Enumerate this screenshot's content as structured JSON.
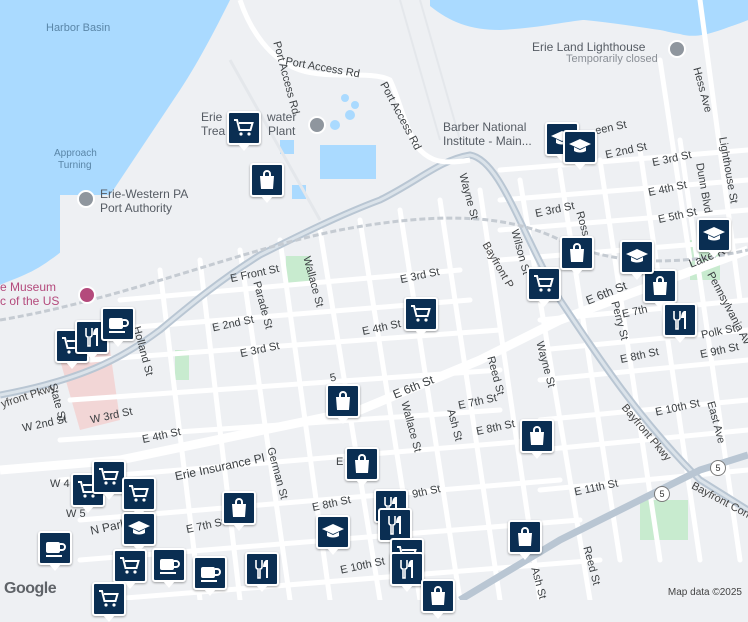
{
  "map": {
    "water_color": "#aadaff",
    "land_color": "#eef0f3",
    "road_color": "#ffffff",
    "park_color": "#c8ebcf",
    "highway_color": "#b9c6d3",
    "pin_color": "#0a2e52"
  },
  "labels": {
    "harbor_basin": "Harbor Basin",
    "approach": "Approach",
    "turning": "Turning",
    "port_authority_1": "Erie-Western PA",
    "port_authority_2": "Port Authority",
    "museum_1": "e Museum",
    "museum_2": "c of the US",
    "lighthouse": "Erie Land Lighthouse",
    "temporarily_closed": "Temporarily closed",
    "water_plant_1": "Erie",
    "water_plant_2": "water",
    "water_plant_3": "Trea",
    "water_plant_4": "Plant",
    "barber_1": "Barber National",
    "barber_2": "Institute - Main...",
    "port_access_rd_1": "Port Access Rd",
    "port_access_rd_2": "Port Access Rd",
    "port_access_rd_3": "Port Access Rd",
    "hess_ave": "Hess Ave",
    "lighthouse_st": "Lighthouse St",
    "dunn_blvd": "Dunn Blvd",
    "e_2nd_st_a": "E 2nd St",
    "e_3rd_st_a": "E 3rd St",
    "e_4th_st_a": "E 4th St",
    "e_5th_st_a": "E 5th St",
    "e_3rd_st_b": "E 3rd St",
    "e_front_st": "E Front St",
    "wallace_st": "Wallace St",
    "parade_st": "Parade St",
    "e_3rd_st_c": "E 3rd St",
    "e_2nd_st_b": "E 2nd St",
    "e_3rd_st_d": "E 3rd St",
    "e_4th_st_b": "E 4th St",
    "e_6th_st_a": "E 6th St",
    "e_6th_st_b": "E 6th St",
    "wayne_st_a": "Wayne St",
    "wayne_st_b": "Wayne St",
    "bayfront_pkwy_a": "Bayfront P",
    "bayfront_pkwy_b": "Bayfront Pkwy",
    "bayfront_pkwy_c": "Bayfront Pkwy",
    "bayfront_conn": "Bayfront Conn",
    "wilson_st": "Wilson St",
    "ross_st": "Ross St",
    "perry_st": "Perry St",
    "lake_rd": "Lake R",
    "pennsylvania_ave": "Pennsylvania Av",
    "e_7th_a": "E 7th",
    "polk_st": "Polk St",
    "e_8th_st_a": "E 8th St",
    "e_9th_st_a": "E 9th St",
    "e_10th_st_a": "E 10th St",
    "east_ave": "East Ave",
    "reed_st_a": "Reed St",
    "e_7th_st_b": "E 7th St",
    "e_8th_st_b": "E 8th St",
    "ash_st_a": "Ash St",
    "wallace_st_b": "Wallace St",
    "e_11th_st": "E 11th St",
    "e_9th_st_b": "9th St",
    "e_8th_st_c": "E 8th St",
    "e_10th_st_b": "E 10th St",
    "reed_st_b": "Reed St",
    "ash_st_b": "Ash St",
    "german_st": "German St",
    "erie_insurance_pl": "Erie Insurance Pl",
    "e_7th_st_c": "E 7th St",
    "holland_st": "Holland St",
    "state_st": "State St",
    "w_2nd_st": "W 2nd St",
    "w_3rd_st": "W 3rd St",
    "e_4th_st_c": "E 4th St",
    "n_park": "N Park",
    "w_4": "W 4",
    "w_5": "W 5",
    "bayfront_pkwy_w": "yfront Pkwy",
    "route_5_a": "5",
    "route_5_b": "5",
    "e_5_partial": "E",
    "e_4th_partial": "4th St",
    "e_5_st": "5",
    "reen_st": "een St",
    "e_2nd_st_c": "E 2nd St",
    "e_3rd_st_e": "E 3rd St",
    "e_4th_st_d": "E 4th St",
    "e_5th_st_b": "E 5th St",
    "e_6th_partial": "E 6th St"
  },
  "pins": [
    {
      "id": "grocery",
      "name": "grocery-pin"
    },
    {
      "id": "shopping",
      "name": "shopping-pin"
    },
    {
      "id": "school",
      "name": "school-pin"
    },
    {
      "id": "restaurant",
      "name": "restaurant-pin"
    },
    {
      "id": "cafe",
      "name": "cafe-pin"
    }
  ],
  "footer": {
    "google": "Google",
    "attribution": "Map data ©2025"
  }
}
